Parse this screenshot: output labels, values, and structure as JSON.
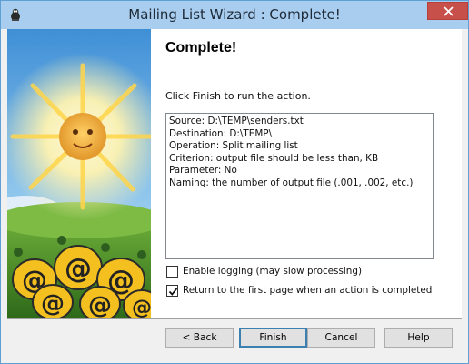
{
  "window": {
    "title": "Mailing List Wizard : Complete!",
    "icon": "app-icon",
    "close_icon": "close-icon",
    "colors": {
      "titlebar": "#a9cdee",
      "close": "#c7504b"
    }
  },
  "page": {
    "heading": "Complete!",
    "instruction": "Click Finish to run the action.",
    "summary_lines": [
      "Source: D:\\TEMP\\senders.txt",
      "Destination: D:\\TEMP\\",
      "Operation: Split mailing list",
      "Criterion: output file should be less than, KB",
      "Parameter: No",
      "Naming: the number of output file (.001, .002, etc.)"
    ]
  },
  "options": {
    "logging_label": "Enable logging (may slow processing)",
    "logging_checked": false,
    "return_label": "Return to the first page when an action is completed",
    "return_checked": true
  },
  "buttons": {
    "back": "< Back",
    "finish": "Finish",
    "cancel": "Cancel",
    "help": "Help"
  }
}
